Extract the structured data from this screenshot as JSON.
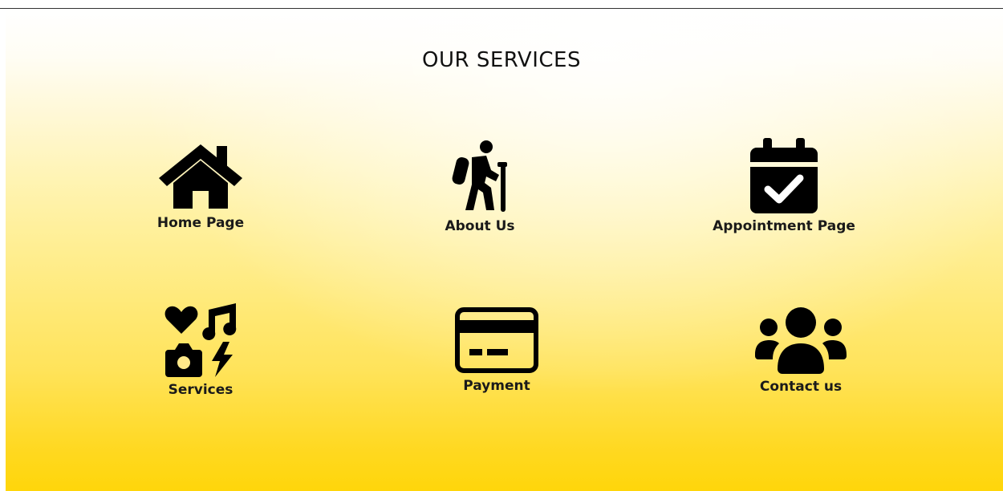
{
  "page": {
    "title": "OUR SERVICES"
  },
  "services": [
    {
      "label": "Home Page",
      "icon": "house-icon"
    },
    {
      "label": "About Us",
      "icon": "hiker-icon"
    },
    {
      "label": "Appointment Page",
      "icon": "calendar-check-icon"
    },
    {
      "label": "Services",
      "icon": "icons-collection-icon"
    },
    {
      "label": "Payment",
      "icon": "credit-card-icon"
    },
    {
      "label": "Contact us",
      "icon": "users-icon"
    }
  ],
  "colors": {
    "gradient_top": "#ffffff",
    "gradient_bottom": "#ffd60a",
    "text": "#111111"
  }
}
